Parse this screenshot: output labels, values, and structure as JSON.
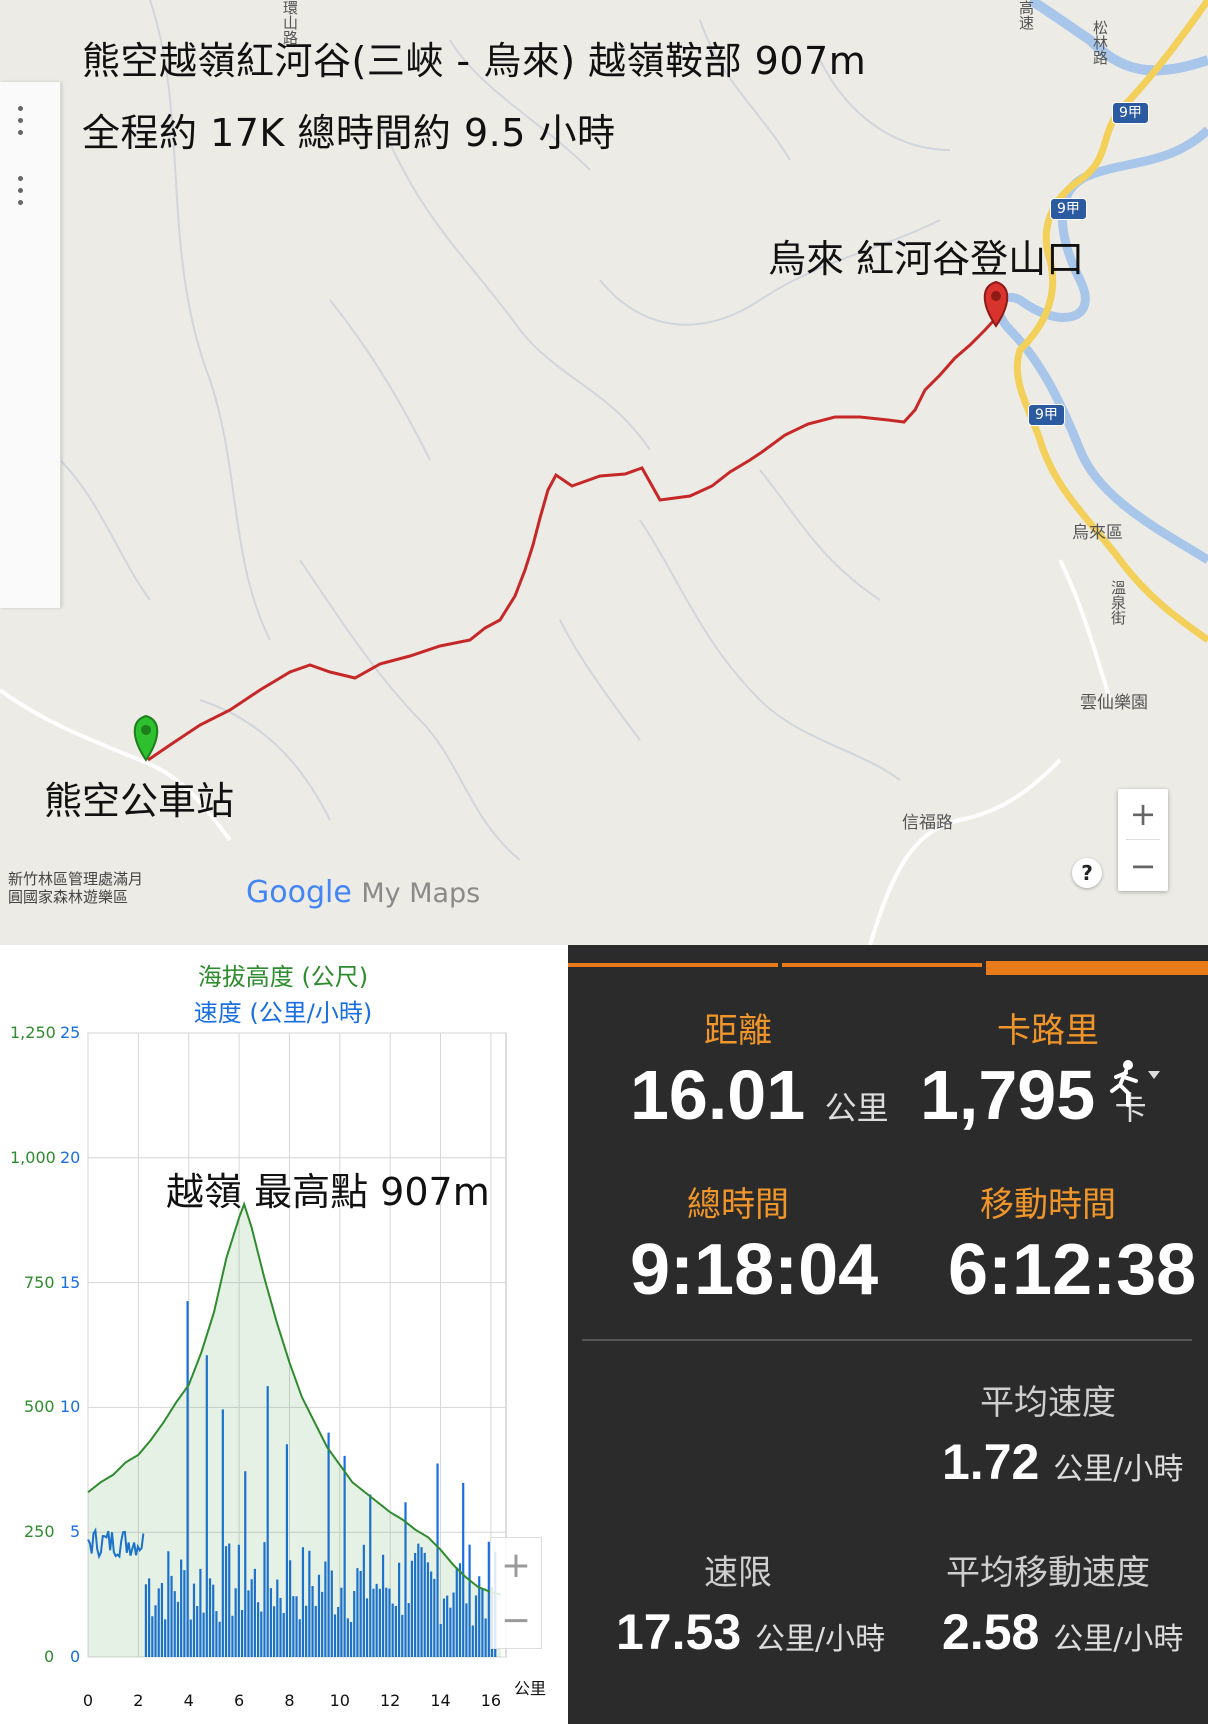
{
  "map": {
    "title_line1": "熊空越嶺紅河谷(三峽 - 烏來) 越嶺鞍部 907m",
    "title_line2": "全程約 17K  總時間約 9.5 小時",
    "end_label": "烏來 紅河谷登山口",
    "start_label": "熊空公車站",
    "route_color": "#c62828",
    "start_marker_color": "#2ec02e",
    "end_marker_color": "#d9332e",
    "road_badge": "9甲",
    "place_wulai": "烏來區",
    "place_yunxian": "雲仙樂園",
    "place_xinfu": "信福路",
    "place_wenquan": "溫泉街",
    "place_tl1": "環山路",
    "place_tl2": "高速",
    "place_tl3": "松林路",
    "footer_note_line1": "新竹林區管理處滿月",
    "footer_note_line2": "圓國家森林遊樂區",
    "logo_google": "Google",
    "logo_mymaps": "My Maps",
    "help": "?",
    "zoom_in": "+",
    "zoom_out": "−"
  },
  "chart_data": {
    "type": "line",
    "series": [
      {
        "name": "海拔高度 (公尺)",
        "axis": "left",
        "color": "#2e8b2e"
      },
      {
        "name": "速度 (公里/小時)",
        "axis": "right",
        "color": "#1a6fe0"
      }
    ],
    "xlabel": "公里",
    "xlim": [
      0,
      16.6
    ],
    "ylim_left": [
      0,
      1250
    ],
    "ylim_right": [
      0,
      25
    ],
    "x_ticks": [
      "0",
      "2",
      "4",
      "6",
      "8",
      "10",
      "12",
      "14",
      "16"
    ],
    "y_ticks_left": [
      "0",
      "250",
      "500",
      "750",
      "1,000",
      "1,250"
    ],
    "y_ticks_right": [
      "0",
      "5",
      "10",
      "15",
      "20",
      "25"
    ],
    "elevation": [
      [
        0,
        330
      ],
      [
        0.5,
        350
      ],
      [
        1.0,
        365
      ],
      [
        1.5,
        390
      ],
      [
        2.0,
        405
      ],
      [
        2.5,
        435
      ],
      [
        3.0,
        470
      ],
      [
        3.5,
        510
      ],
      [
        4.0,
        545
      ],
      [
        4.5,
        610
      ],
      [
        5.0,
        690
      ],
      [
        5.5,
        800
      ],
      [
        6.0,
        880
      ],
      [
        6.2,
        907
      ],
      [
        6.5,
        860
      ],
      [
        7.0,
        760
      ],
      [
        7.5,
        670
      ],
      [
        8.0,
        590
      ],
      [
        8.5,
        520
      ],
      [
        9.0,
        470
      ],
      [
        9.5,
        420
      ],
      [
        10.0,
        385
      ],
      [
        10.5,
        350
      ],
      [
        11.0,
        330
      ],
      [
        11.5,
        310
      ],
      [
        12.0,
        290
      ],
      [
        12.5,
        275
      ],
      [
        13.0,
        255
      ],
      [
        13.5,
        240
      ],
      [
        14.0,
        215
      ],
      [
        14.5,
        185
      ],
      [
        15.0,
        160
      ],
      [
        15.5,
        140
      ],
      [
        16.0,
        130
      ],
      [
        16.4,
        125
      ]
    ],
    "annotation": "越嶺   最高點 907m"
  },
  "stats": {
    "distance_label": "距離",
    "distance_value": "16.01",
    "distance_unit": "公里",
    "calories_label": "卡路里",
    "calories_value": "1,795",
    "calories_unit": "卡",
    "total_time_label": "總時間",
    "total_time_value": "9:18:04",
    "moving_time_label": "移動時間",
    "moving_time_value": "6:12:38",
    "avg_speed_label": "平均速度",
    "avg_speed_value": "1.72",
    "speed_unit": "公里/小時",
    "max_speed_label": "速限",
    "max_speed_value": "17.53",
    "avg_moving_speed_label": "平均移動速度",
    "avg_moving_speed_value": "2.58",
    "activity_icon": "running-icon",
    "accent_color": "#f0952a"
  }
}
